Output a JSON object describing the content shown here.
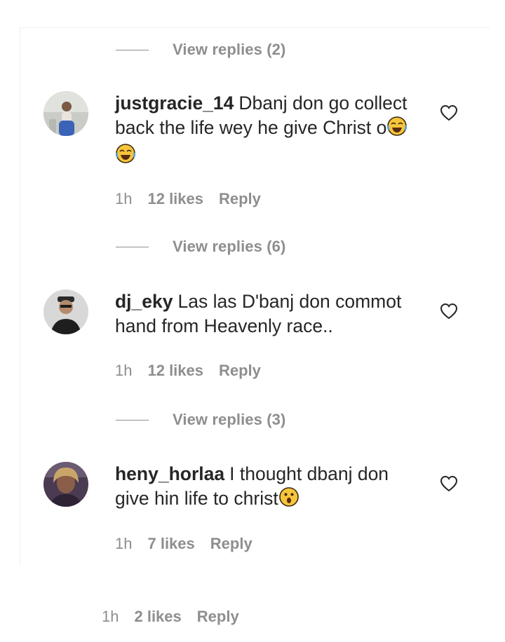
{
  "thread": {
    "first_view_replies": "View replies (2)",
    "comments": [
      {
        "username": "justgracie_14",
        "text": "Dbanj don go collect back the life wey he give Christ o",
        "emoji": "tears-of-joy-emoji",
        "time": "1h",
        "likes": "12 likes",
        "reply": "Reply",
        "view_replies": "View replies (6)"
      },
      {
        "username": "dj_eky",
        "text": "Las las D'banj don commot hand from Heavenly race..",
        "time": "1h",
        "likes": "12 likes",
        "reply": "Reply",
        "view_replies": "View replies (3)"
      },
      {
        "username": "heny_horlaa",
        "text": "I thought dbanj don give hin life to christ",
        "emoji": "astonished-emoji",
        "time": "1h",
        "likes": "7 likes",
        "reply": "Reply"
      }
    ]
  },
  "post_meta": {
    "time": "1h",
    "likes": "2 likes",
    "reply": "Reply"
  },
  "colors": {
    "text": "#262626",
    "secondary": "#8e8e8e",
    "divider": "#efefef"
  }
}
